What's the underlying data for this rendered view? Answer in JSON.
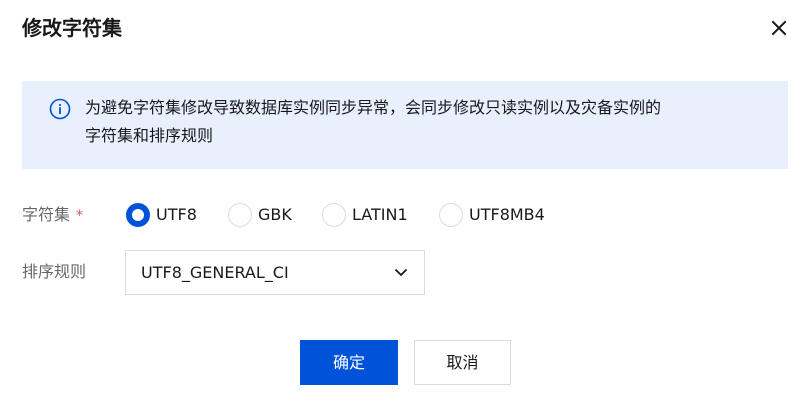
{
  "dialog": {
    "title": "修改字符集",
    "close_icon": "close-icon"
  },
  "notice": {
    "icon": "info-circle-icon",
    "line1": "为避免字符集修改导致数据库实例同步异常，会同步修改只读实例以及灾备实例的",
    "line2": "字符集和排序规则"
  },
  "form": {
    "charset_label": "字符集",
    "required_mark": "*",
    "charset_options": [
      {
        "label": "UTF8",
        "checked": true
      },
      {
        "label": "GBK",
        "checked": false
      },
      {
        "label": "LATIN1",
        "checked": false
      },
      {
        "label": "UTF8MB4",
        "checked": false
      }
    ],
    "collation_label": "排序规则",
    "collation_value": "UTF8_GENERAL_CI",
    "collation_arrow_icon": "chevron-down-icon"
  },
  "footer": {
    "confirm_label": "确定",
    "cancel_label": "取消"
  },
  "colors": {
    "primary": "#0052d9",
    "notice_background": "#e8f0fe",
    "required": "#e34d59",
    "border": "#dcdcdc"
  }
}
